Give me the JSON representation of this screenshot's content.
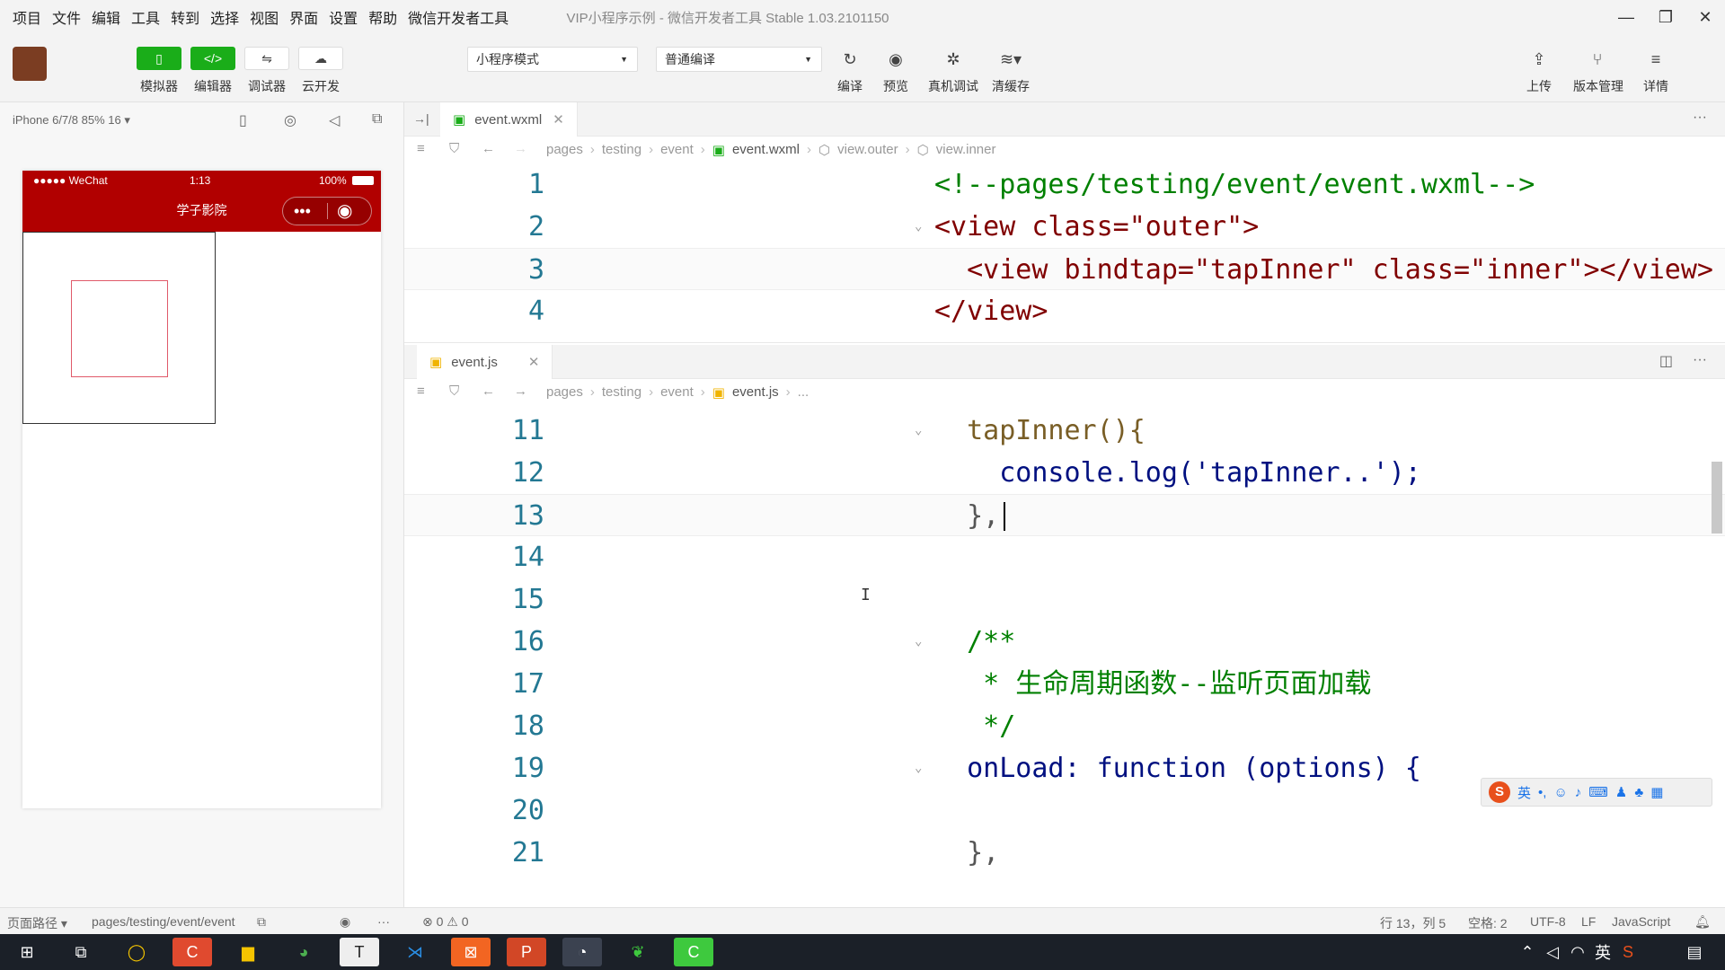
{
  "menubar": {
    "items": [
      "项目",
      "文件",
      "编辑",
      "工具",
      "转到",
      "选择",
      "视图",
      "界面",
      "设置",
      "帮助",
      "微信开发者工具"
    ],
    "title": "VIP小程序示例 - 微信开发者工具 Stable 1.03.2101150"
  },
  "toolbar": {
    "simulator": "模拟器",
    "editor": "编辑器",
    "debugger": "调试器",
    "cloud": "云开发",
    "mode_select": "小程序模式",
    "compile_select": "普通编译",
    "compile": "编译",
    "preview": "预览",
    "real_debug": "真机调试",
    "clear_cache": "清缓存",
    "upload": "上传",
    "version": "版本管理",
    "details": "详情"
  },
  "simulator": {
    "device": "iPhone 6/7/8 85% 16 ▾",
    "status_carrier": "●●●●● WeChat",
    "status_time": "1:13",
    "status_battery": "100%",
    "nav_title": "学子影院"
  },
  "editor_top": {
    "tab": "event.wxml",
    "crumbs": [
      "pages",
      "testing",
      "event",
      "event.wxml",
      "view.outer",
      "view.inner"
    ],
    "lines": [
      {
        "n": "1",
        "text": "<!--pages/testing/event/event.wxml-->"
      },
      {
        "n": "2",
        "text": "<view class=\"outer\">"
      },
      {
        "n": "3",
        "text": "  <view bindtap=\"tapInner\" class=\"inner\"></view>"
      },
      {
        "n": "4",
        "text": "</view>"
      }
    ]
  },
  "editor_bottom": {
    "tab": "event.js",
    "crumbs": [
      "pages",
      "testing",
      "event",
      "event.js",
      "..."
    ],
    "lines": [
      {
        "n": "11",
        "text": "  tapInner(){"
      },
      {
        "n": "12",
        "text": "    console.log('tapInner..');"
      },
      {
        "n": "13",
        "text": "  },"
      },
      {
        "n": "14",
        "text": ""
      },
      {
        "n": "15",
        "text": ""
      },
      {
        "n": "16",
        "text": "  /**"
      },
      {
        "n": "17",
        "text": "   * 生命周期函数--监听页面加载"
      },
      {
        "n": "18",
        "text": "   */"
      },
      {
        "n": "19",
        "text": "  onLoad: function (options) {"
      },
      {
        "n": "20",
        "text": ""
      },
      {
        "n": "21",
        "text": "  },"
      }
    ]
  },
  "statusbar": {
    "page_path_label": "页面路径 ▾",
    "page_path": "pages/testing/event/event",
    "problems": "⊗ 0 ⚠ 0",
    "cursor": "行 13，列 5",
    "spaces": "空格: 2",
    "encoding": "UTF-8",
    "eol": "LF",
    "language": "JavaScript"
  },
  "ime": {
    "label": "英"
  }
}
